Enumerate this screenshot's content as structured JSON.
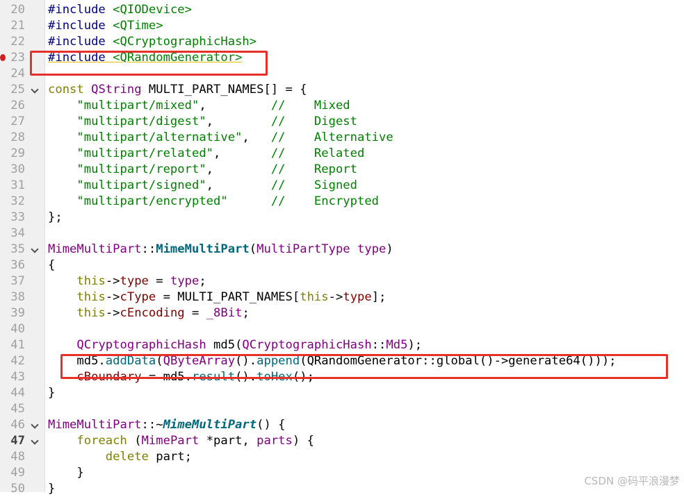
{
  "editor": {
    "lines": [
      {
        "n": "20",
        "fold": false,
        "segs": [
          [
            "tok-pre",
            "#include"
          ],
          [
            "",
            " "
          ],
          [
            "tok-inc",
            "<QIODevice>"
          ]
        ]
      },
      {
        "n": "21",
        "fold": false,
        "segs": [
          [
            "tok-pre",
            "#include"
          ],
          [
            "",
            " "
          ],
          [
            "tok-inc",
            "<QTime>"
          ]
        ]
      },
      {
        "n": "22",
        "fold": false,
        "segs": [
          [
            "tok-pre",
            "#include"
          ],
          [
            "",
            " "
          ],
          [
            "tok-inc",
            "<QCryptographicHash>"
          ]
        ]
      },
      {
        "n": "23",
        "fold": false,
        "breakpoint": true,
        "segs": [
          [
            "tok-pre squiggle",
            "#include"
          ],
          [
            "squiggle",
            " "
          ],
          [
            "tok-inc squiggle",
            "<QRandomGenerator>"
          ]
        ]
      },
      {
        "n": "24",
        "fold": false,
        "segs": []
      },
      {
        "n": "25",
        "fold": true,
        "segs": [
          [
            "tok-kw",
            "const"
          ],
          [
            "",
            " "
          ],
          [
            "tok-type",
            "QString"
          ],
          [
            "",
            " MULTI_PART_NAMES[] = {"
          ]
        ]
      },
      {
        "n": "26",
        "fold": false,
        "segs": [
          [
            "",
            "    "
          ],
          [
            "tok-str",
            "\"multipart/mixed\""
          ],
          [
            "",
            ",         "
          ],
          [
            "tok-cmt",
            "//    Mixed"
          ]
        ]
      },
      {
        "n": "27",
        "fold": false,
        "segs": [
          [
            "",
            "    "
          ],
          [
            "tok-str",
            "\"multipart/digest\""
          ],
          [
            "",
            ",        "
          ],
          [
            "tok-cmt",
            "//    Digest"
          ]
        ]
      },
      {
        "n": "28",
        "fold": false,
        "segs": [
          [
            "",
            "    "
          ],
          [
            "tok-str",
            "\"multipart/alternative\""
          ],
          [
            "",
            ",   "
          ],
          [
            "tok-cmt",
            "//    Alternative"
          ]
        ]
      },
      {
        "n": "29",
        "fold": false,
        "segs": [
          [
            "",
            "    "
          ],
          [
            "tok-str",
            "\"multipart/related\""
          ],
          [
            "",
            ",       "
          ],
          [
            "tok-cmt",
            "//    Related"
          ]
        ]
      },
      {
        "n": "30",
        "fold": false,
        "segs": [
          [
            "",
            "    "
          ],
          [
            "tok-str",
            "\"multipart/report\""
          ],
          [
            "",
            ",        "
          ],
          [
            "tok-cmt",
            "//    Report"
          ]
        ]
      },
      {
        "n": "31",
        "fold": false,
        "segs": [
          [
            "",
            "    "
          ],
          [
            "tok-str",
            "\"multipart/signed\""
          ],
          [
            "",
            ",        "
          ],
          [
            "tok-cmt",
            "//    Signed"
          ]
        ]
      },
      {
        "n": "32",
        "fold": false,
        "segs": [
          [
            "",
            "    "
          ],
          [
            "tok-str",
            "\"multipart/encrypted\""
          ],
          [
            "",
            "      "
          ],
          [
            "tok-cmt",
            "//    Encrypted"
          ]
        ]
      },
      {
        "n": "33",
        "fold": false,
        "segs": [
          [
            "",
            "};"
          ]
        ]
      },
      {
        "n": "34",
        "fold": false,
        "segs": []
      },
      {
        "n": "35",
        "fold": true,
        "segs": [
          [
            "tok-type",
            "MimeMultiPart"
          ],
          [
            "",
            "::"
          ],
          [
            "tok-fn",
            "MimeMultiPart"
          ],
          [
            "",
            "("
          ],
          [
            "tok-type",
            "MultiPartType"
          ],
          [
            "",
            " "
          ],
          [
            "tok-type",
            "type"
          ],
          [
            "",
            ")"
          ]
        ]
      },
      {
        "n": "36",
        "fold": false,
        "segs": [
          [
            "",
            "{"
          ]
        ]
      },
      {
        "n": "37",
        "fold": false,
        "segs": [
          [
            "",
            "    "
          ],
          [
            "tok-this",
            "this"
          ],
          [
            "",
            "->"
          ],
          [
            "tok-mem",
            "type"
          ],
          [
            "",
            " = "
          ],
          [
            "tok-type",
            "type"
          ],
          [
            "",
            ";"
          ]
        ]
      },
      {
        "n": "38",
        "fold": false,
        "segs": [
          [
            "",
            "    "
          ],
          [
            "tok-this",
            "this"
          ],
          [
            "",
            "->"
          ],
          [
            "tok-mem",
            "cType"
          ],
          [
            "",
            " = MULTI_PART_NAMES["
          ],
          [
            "tok-this",
            "this"
          ],
          [
            "",
            "->"
          ],
          [
            "tok-mem",
            "type"
          ],
          [
            "",
            "];"
          ]
        ]
      },
      {
        "n": "39",
        "fold": false,
        "segs": [
          [
            "",
            "    "
          ],
          [
            "tok-this",
            "this"
          ],
          [
            "",
            "->"
          ],
          [
            "tok-mem",
            "cEncoding"
          ],
          [
            "",
            " = "
          ],
          [
            "tok-type",
            "_8Bit"
          ],
          [
            "",
            ";"
          ]
        ]
      },
      {
        "n": "40",
        "fold": false,
        "segs": []
      },
      {
        "n": "41",
        "fold": false,
        "segs": [
          [
            "",
            "    "
          ],
          [
            "tok-type",
            "QCryptographicHash"
          ],
          [
            "",
            " md5("
          ],
          [
            "tok-type",
            "QCryptographicHash"
          ],
          [
            "",
            "::"
          ],
          [
            "tok-type",
            "Md5"
          ],
          [
            "",
            ");"
          ]
        ]
      },
      {
        "n": "42",
        "fold": false,
        "segs": [
          [
            "",
            "    md5."
          ],
          [
            "tok-call",
            "addData"
          ],
          [
            "",
            "("
          ],
          [
            "tok-type",
            "QByteArray"
          ],
          [
            "",
            "()."
          ],
          [
            "tok-call",
            "append"
          ],
          [
            "",
            "(QRandomGenerator::global()->generate64()));"
          ]
        ]
      },
      {
        "n": "43",
        "fold": false,
        "segs": [
          [
            "",
            "    "
          ],
          [
            "tok-mem",
            "cBoundary"
          ],
          [
            "",
            " = md5."
          ],
          [
            "tok-call",
            "result"
          ],
          [
            "",
            "()."
          ],
          [
            "tok-call",
            "toHex"
          ],
          [
            "",
            "();"
          ]
        ]
      },
      {
        "n": "44",
        "fold": false,
        "segs": [
          [
            "",
            "}"
          ]
        ]
      },
      {
        "n": "45",
        "fold": false,
        "segs": []
      },
      {
        "n": "46",
        "fold": true,
        "segs": [
          [
            "tok-type",
            "MimeMultiPart"
          ],
          [
            "",
            "::~"
          ],
          [
            "tok-fni",
            "MimeMultiPart"
          ],
          [
            "",
            "() {"
          ]
        ]
      },
      {
        "n": "47",
        "fold": true,
        "bold": true,
        "segs": [
          [
            "",
            "    "
          ],
          [
            "tok-kw",
            "foreach"
          ],
          [
            "",
            " ("
          ],
          [
            "tok-type",
            "MimePart"
          ],
          [
            "",
            " *part, "
          ],
          [
            "tok-type",
            "parts"
          ],
          [
            "",
            ") {"
          ]
        ]
      },
      {
        "n": "48",
        "fold": false,
        "segs": [
          [
            "",
            "        "
          ],
          [
            "tok-kw",
            "delete"
          ],
          [
            "",
            " part;"
          ]
        ]
      },
      {
        "n": "49",
        "fold": false,
        "segs": [
          [
            "",
            "    }"
          ]
        ]
      },
      {
        "n": "50",
        "fold": false,
        "segs": [
          [
            "",
            "}"
          ]
        ]
      }
    ]
  },
  "watermark": "CSDN @码平浪漫梦"
}
